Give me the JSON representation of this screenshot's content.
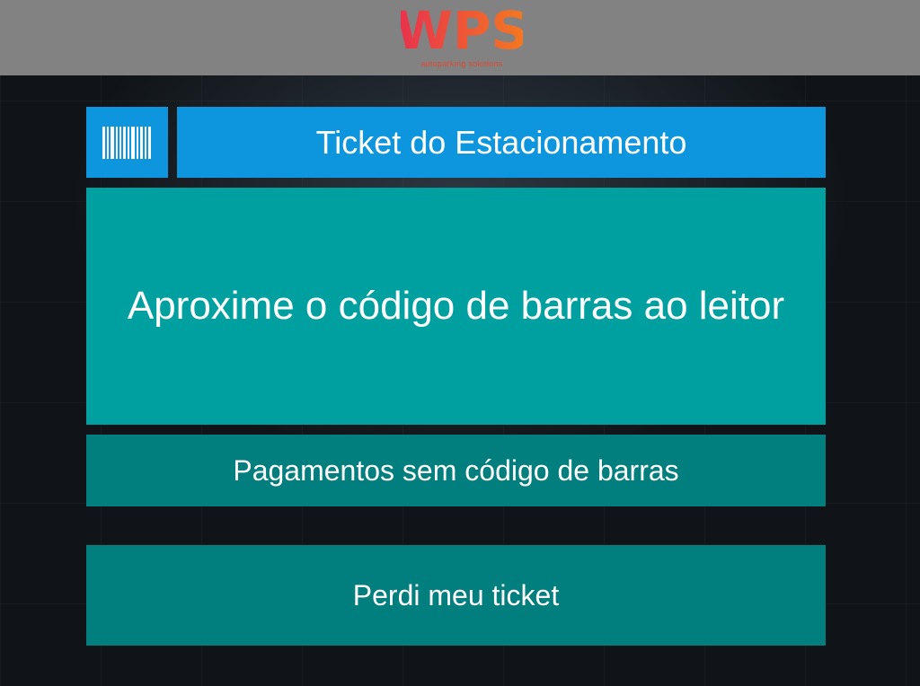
{
  "header": {
    "logo_text": "WPS",
    "logo_tagline": "autoparking solutions",
    "colors": {
      "bar": "#828282",
      "logo_start": "#e8304f",
      "logo_end": "#f47a1f"
    }
  },
  "ticket": {
    "icon": "barcode-icon",
    "title": "Ticket do Estacionamento",
    "scan_prompt": "Aproxime o código de barras ao leitor"
  },
  "actions": {
    "no_barcode_label": "Pagamentos sem código de barras",
    "lost_ticket_label": "Perdi meu ticket"
  },
  "colors": {
    "title_blue": "#0d96dd",
    "scan_teal": "#00a0a0",
    "button_teal": "#017e7e"
  }
}
